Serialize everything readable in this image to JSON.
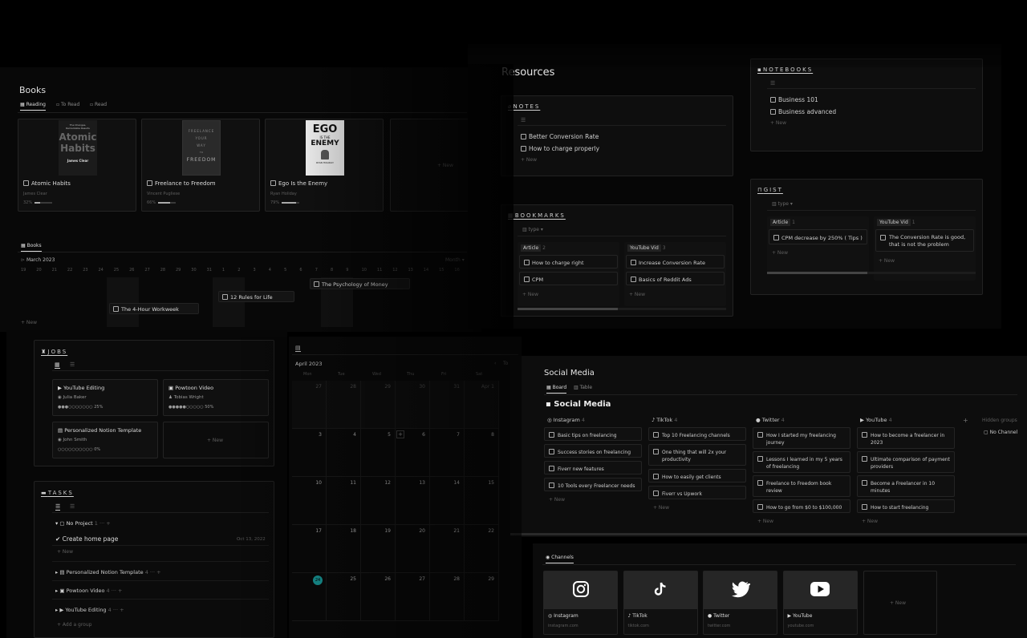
{
  "books": {
    "title": "Books",
    "tabs": [
      "Reading",
      "To Read",
      "Read"
    ],
    "cards": [
      {
        "name": "Atomic Habits",
        "author": "James Clear",
        "progress": "32%",
        "fill": 0.32,
        "cover_lines": [
          "The Changes,",
          "Remarkable Results",
          "Atomic",
          "Habits",
          "James Clear"
        ]
      },
      {
        "name": "Freelance to Freedom",
        "author": "Vincent Pugliese",
        "progress": "66%",
        "fill": 0.66,
        "cover_lines": [
          "FREELANCE",
          "YOUR",
          "WAY",
          "TO",
          "FREEDOM"
        ]
      },
      {
        "name": "Ego Is the Enemy",
        "author": "Ryan Holiday",
        "progress": "79%",
        "fill": 0.79,
        "cover_lines": [
          "EGO",
          "IS THE",
          "ENEMY",
          "RYAN HOLIDAY"
        ]
      }
    ],
    "new_label": "+ New",
    "timeline": {
      "tab": "Books",
      "month": "March 2023",
      "view": "Month",
      "days": [
        "19",
        "20",
        "21",
        "22",
        "23",
        "24",
        "25",
        "26",
        "27",
        "28",
        "29",
        "30",
        "31",
        "1",
        "2",
        "3",
        "4",
        "5",
        "6",
        "7",
        "8",
        "9",
        "10",
        "11",
        "12",
        "13",
        "14",
        "15",
        "16"
      ],
      "items": [
        "The Psychology of Money",
        "12 Rules for Life",
        "The 4-Hour Workweek"
      ],
      "new_label": "+ New"
    }
  },
  "resources": {
    "title": "Resources",
    "notes": {
      "title": "NOTES",
      "items": [
        "Better Conversion Rate",
        "How to charge properly"
      ],
      "new_label": "+ New"
    },
    "notebooks": {
      "title": "NOTEBOOKS",
      "items": [
        "Business 101",
        "Business advanced"
      ],
      "new_label": "+ New"
    },
    "bookmarks": {
      "title": "BOOKMARKS",
      "filter": "type",
      "groups": [
        {
          "name": "Article",
          "count": "2",
          "items": [
            "How to charge right",
            "CPM"
          ]
        },
        {
          "name": "YouTube Vid",
          "count": "3",
          "items": [
            "Increase Conversion Rate",
            "Basics of Reddit Ads"
          ]
        }
      ],
      "new_label": "+ New"
    },
    "gist": {
      "title": "GIST",
      "filter": "type",
      "groups": [
        {
          "name": "Article",
          "count": "1",
          "items": [
            "CPM  decrease by 250% ( Tips )"
          ]
        },
        {
          "name": "YouTube Vid",
          "count": "1",
          "items": [
            "The Conversion Rate is good, that is not the problem"
          ]
        }
      ],
      "new_label": "+ New"
    }
  },
  "jobs": {
    "title": "JOBS",
    "cards": [
      {
        "name": "YouTube Editing",
        "person": "Julia Baker",
        "rating": "●●●○○○○○○○ 25%"
      },
      {
        "name": "Powtoon Video",
        "person": "Tobias Wright",
        "rating": "●●●●●○○○○○ 50%"
      },
      {
        "name": "Personalized Notion Template",
        "person": "John Smith",
        "rating": "○○○○○○○○○○ 0%"
      }
    ],
    "new_label": "+ New"
  },
  "tasks": {
    "title": "TASKS",
    "no_project": {
      "label": "No Project",
      "count": "1"
    },
    "task": {
      "name": "Create home page",
      "date": "Oct 13, 2022"
    },
    "new_label": "+ New",
    "groups": [
      {
        "label": "Personalized Notion Template",
        "count": "4"
      },
      {
        "label": "Powtoon Video",
        "count": "4"
      },
      {
        "label": "YouTube Editing",
        "count": "4"
      }
    ],
    "add_group": "+ Add a group"
  },
  "calendar": {
    "month": "April 2023",
    "today": "To",
    "weekdays": [
      "Mon",
      "Tue",
      "Wed",
      "Thu",
      "Fri",
      "Sat"
    ],
    "weeks": [
      [
        "27",
        "28",
        "29",
        "30",
        "31",
        "Apr 1"
      ],
      [
        "3",
        "4",
        "5",
        "6",
        "7",
        "8"
      ],
      [
        "10",
        "11",
        "12",
        "13",
        "14",
        "15"
      ],
      [
        "17",
        "18",
        "19",
        "20",
        "21",
        "22"
      ],
      [
        "24",
        "25",
        "26",
        "27",
        "28",
        "29"
      ]
    ]
  },
  "social": {
    "title": "Social Media",
    "tabs": [
      "Board",
      "Table"
    ],
    "heading": "Social Media",
    "columns": [
      {
        "name": "Instagram",
        "count": "4",
        "items": [
          "Basic tips on freelancing",
          "Success stories on freelancing",
          "Fiverr new features",
          "10 Tools every Freelancer needs"
        ]
      },
      {
        "name": "TikTok",
        "count": "4",
        "items": [
          "Top 10 Freelancing channels",
          "One thing that will 2x your productivity",
          "How to easily get clients",
          "Fiverr vs Upwork"
        ]
      },
      {
        "name": "Twitter",
        "count": "4",
        "items": [
          "How I started my freelancing journey",
          "Lessons I learned in my 5 years of freelancing",
          "Freelance to Freedom book review",
          "How to go from $0 to $100,000"
        ]
      },
      {
        "name": "YouTube",
        "count": "4",
        "items": [
          "How to become a freelancer in 2023",
          "Ultimate comparison of payment providers",
          "Become a Freelancer in 10 minutes",
          "How to start freelancing"
        ]
      }
    ],
    "hidden_groups": "Hidden groups",
    "no_channel": "No Channel",
    "plus": "+",
    "new_label": "+ New",
    "channels": {
      "tab": "Channels",
      "items": [
        {
          "name": "Instagram",
          "url": "instagram.com"
        },
        {
          "name": "TikTok",
          "url": "tiktok.com"
        },
        {
          "name": "Twitter",
          "url": "twitter.com"
        },
        {
          "name": "YouTube",
          "url": "youtube.com"
        }
      ],
      "new_label": "+ New"
    }
  },
  "colors": {
    "accent": "#1aa3a3",
    "bg": "#0c0c0c",
    "border": "#242424"
  }
}
